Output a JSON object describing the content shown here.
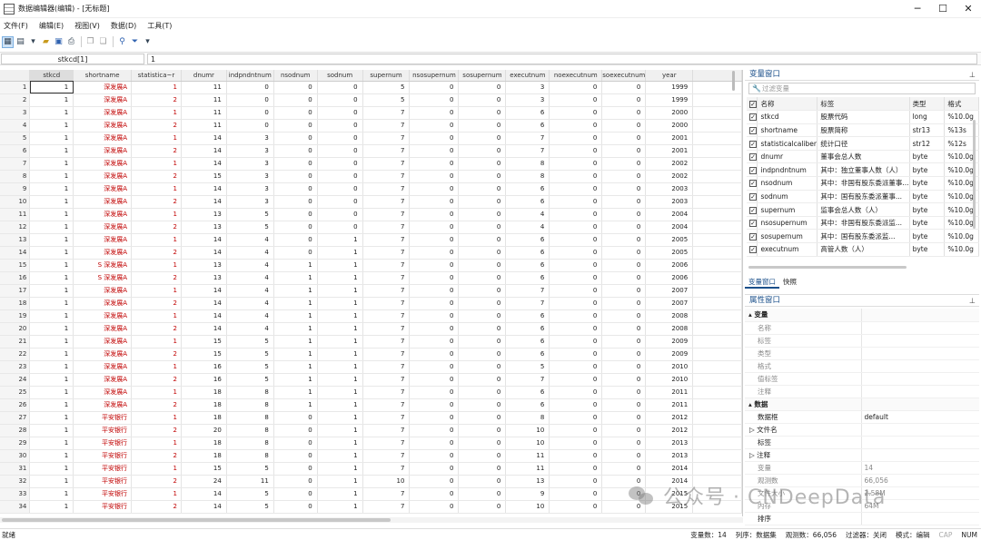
{
  "window": {
    "title": "数据编辑器(编辑) - [无标题]",
    "controls": [
      "─",
      "☐",
      "✕"
    ]
  },
  "menu": [
    "文件(F)",
    "编辑(E)",
    "视图(V)",
    "数据(D)",
    "工具(T)"
  ],
  "cellref": {
    "name": "stkcd[1]",
    "value": "1"
  },
  "grid": {
    "columns": [
      "stkcd",
      "shortname",
      "statistica~r",
      "dnumr",
      "indpndntnum",
      "nsodnum",
      "sodnum",
      "supernum",
      "nsosupernum",
      "sosupernum",
      "executnum",
      "noexecutnum",
      "soexecutnum",
      "year"
    ],
    "rows": [
      [
        "1",
        "深发展A",
        "1",
        "11",
        "0",
        "0",
        "0",
        "5",
        "0",
        "0",
        "3",
        "0",
        "0",
        "1999"
      ],
      [
        "1",
        "深发展A",
        "2",
        "11",
        "0",
        "0",
        "0",
        "5",
        "0",
        "0",
        "3",
        "0",
        "0",
        "1999"
      ],
      [
        "1",
        "深发展A",
        "1",
        "11",
        "0",
        "0",
        "0",
        "7",
        "0",
        "0",
        "6",
        "0",
        "0",
        "2000"
      ],
      [
        "1",
        "深发展A",
        "2",
        "11",
        "0",
        "0",
        "0",
        "7",
        "0",
        "0",
        "6",
        "0",
        "0",
        "2000"
      ],
      [
        "1",
        "深发展A",
        "1",
        "14",
        "3",
        "0",
        "0",
        "7",
        "0",
        "0",
        "7",
        "0",
        "0",
        "2001"
      ],
      [
        "1",
        "深发展A",
        "2",
        "14",
        "3",
        "0",
        "0",
        "7",
        "0",
        "0",
        "7",
        "0",
        "0",
        "2001"
      ],
      [
        "1",
        "深发展A",
        "1",
        "14",
        "3",
        "0",
        "0",
        "7",
        "0",
        "0",
        "8",
        "0",
        "0",
        "2002"
      ],
      [
        "1",
        "深发展A",
        "2",
        "15",
        "3",
        "0",
        "0",
        "7",
        "0",
        "0",
        "8",
        "0",
        "0",
        "2002"
      ],
      [
        "1",
        "深发展A",
        "1",
        "14",
        "3",
        "0",
        "0",
        "7",
        "0",
        "0",
        "6",
        "0",
        "0",
        "2003"
      ],
      [
        "1",
        "深发展A",
        "2",
        "14",
        "3",
        "0",
        "0",
        "7",
        "0",
        "0",
        "6",
        "0",
        "0",
        "2003"
      ],
      [
        "1",
        "深发展A",
        "1",
        "13",
        "5",
        "0",
        "0",
        "7",
        "0",
        "0",
        "4",
        "0",
        "0",
        "2004"
      ],
      [
        "1",
        "深发展A",
        "2",
        "13",
        "5",
        "0",
        "0",
        "7",
        "0",
        "0",
        "4",
        "0",
        "0",
        "2004"
      ],
      [
        "1",
        "深发展A",
        "1",
        "14",
        "4",
        "0",
        "1",
        "7",
        "0",
        "0",
        "6",
        "0",
        "0",
        "2005"
      ],
      [
        "1",
        "深发展A",
        "2",
        "14",
        "4",
        "0",
        "1",
        "7",
        "0",
        "0",
        "6",
        "0",
        "0",
        "2005"
      ],
      [
        "1",
        "S 深发展A",
        "1",
        "13",
        "4",
        "1",
        "1",
        "7",
        "0",
        "0",
        "6",
        "0",
        "0",
        "2006"
      ],
      [
        "1",
        "S 深发展A",
        "2",
        "13",
        "4",
        "1",
        "1",
        "7",
        "0",
        "0",
        "6",
        "0",
        "0",
        "2006"
      ],
      [
        "1",
        "深发展A",
        "1",
        "14",
        "4",
        "1",
        "1",
        "7",
        "0",
        "0",
        "7",
        "0",
        "0",
        "2007"
      ],
      [
        "1",
        "深发展A",
        "2",
        "14",
        "4",
        "1",
        "1",
        "7",
        "0",
        "0",
        "7",
        "0",
        "0",
        "2007"
      ],
      [
        "1",
        "深发展A",
        "1",
        "14",
        "4",
        "1",
        "1",
        "7",
        "0",
        "0",
        "6",
        "0",
        "0",
        "2008"
      ],
      [
        "1",
        "深发展A",
        "2",
        "14",
        "4",
        "1",
        "1",
        "7",
        "0",
        "0",
        "6",
        "0",
        "0",
        "2008"
      ],
      [
        "1",
        "深发展A",
        "1",
        "15",
        "5",
        "1",
        "1",
        "7",
        "0",
        "0",
        "6",
        "0",
        "0",
        "2009"
      ],
      [
        "1",
        "深发展A",
        "2",
        "15",
        "5",
        "1",
        "1",
        "7",
        "0",
        "0",
        "6",
        "0",
        "0",
        "2009"
      ],
      [
        "1",
        "深发展A",
        "1",
        "16",
        "5",
        "1",
        "1",
        "7",
        "0",
        "0",
        "5",
        "0",
        "0",
        "2010"
      ],
      [
        "1",
        "深发展A",
        "2",
        "16",
        "5",
        "1",
        "1",
        "7",
        "0",
        "0",
        "7",
        "0",
        "0",
        "2010"
      ],
      [
        "1",
        "深发展A",
        "1",
        "18",
        "8",
        "1",
        "1",
        "7",
        "0",
        "0",
        "6",
        "0",
        "0",
        "2011"
      ],
      [
        "1",
        "深发展A",
        "2",
        "18",
        "8",
        "1",
        "1",
        "7",
        "0",
        "0",
        "6",
        "0",
        "0",
        "2011"
      ],
      [
        "1",
        "平安银行",
        "1",
        "18",
        "8",
        "0",
        "1",
        "7",
        "0",
        "0",
        "8",
        "0",
        "0",
        "2012"
      ],
      [
        "1",
        "平安银行",
        "2",
        "20",
        "8",
        "0",
        "1",
        "7",
        "0",
        "0",
        "10",
        "0",
        "0",
        "2012"
      ],
      [
        "1",
        "平安银行",
        "1",
        "18",
        "8",
        "0",
        "1",
        "7",
        "0",
        "0",
        "10",
        "0",
        "0",
        "2013"
      ],
      [
        "1",
        "平安银行",
        "2",
        "18",
        "8",
        "0",
        "1",
        "7",
        "0",
        "0",
        "11",
        "0",
        "0",
        "2013"
      ],
      [
        "1",
        "平安银行",
        "1",
        "15",
        "5",
        "0",
        "1",
        "7",
        "0",
        "0",
        "11",
        "0",
        "0",
        "2014"
      ],
      [
        "1",
        "平安银行",
        "2",
        "24",
        "11",
        "0",
        "1",
        "10",
        "0",
        "0",
        "13",
        "0",
        "0",
        "2014"
      ],
      [
        "1",
        "平安银行",
        "1",
        "14",
        "5",
        "0",
        "1",
        "7",
        "0",
        "0",
        "9",
        "0",
        "0",
        "2015"
      ],
      [
        "1",
        "平安银行",
        "2",
        "14",
        "5",
        "0",
        "1",
        "7",
        "0",
        "0",
        "10",
        "0",
        "0",
        "2015"
      ]
    ]
  },
  "varwin": {
    "title": "变量窗口",
    "filter_placeholder": "过滤变量",
    "headers": [
      "名称",
      "标签",
      "类型",
      "格式"
    ],
    "vars": [
      [
        "stkcd",
        "股票代码",
        "long",
        "%10.0g"
      ],
      [
        "shortname",
        "股票简称",
        "str13",
        "%13s"
      ],
      [
        "statisticalcaliber",
        "统计口径",
        "str12",
        "%12s"
      ],
      [
        "dnumr",
        "董事会总人数",
        "byte",
        "%10.0g"
      ],
      [
        "indpndntnum",
        "其中：独立董事人数（人）",
        "byte",
        "%10.0g"
      ],
      [
        "nsodnum",
        "其中：非国有股东委派董事...",
        "byte",
        "%10.0g"
      ],
      [
        "sodnum",
        "其中：国有股东委派董事...",
        "byte",
        "%10.0g"
      ],
      [
        "supernum",
        "监事会总人数（人）",
        "byte",
        "%10.0g"
      ],
      [
        "nsosupernum",
        "其中：非国有股东委派监...",
        "byte",
        "%10.0g"
      ],
      [
        "sosupernum",
        "其中：国有股东委派监...",
        "byte",
        "%10.0g"
      ],
      [
        "executnum",
        "高管人数（人）",
        "byte",
        "%10.0g"
      ]
    ]
  },
  "tabs": [
    "变量窗口",
    "快照"
  ],
  "props": {
    "title": "属性窗口",
    "rows": [
      {
        "t": "grp",
        "k": "▴ 变量",
        "v": ""
      },
      {
        "t": "row",
        "k": "名称",
        "v": ""
      },
      {
        "t": "row",
        "k": "标签",
        "v": ""
      },
      {
        "t": "row",
        "k": "类型",
        "v": ""
      },
      {
        "t": "row",
        "k": "格式",
        "v": ""
      },
      {
        "t": "row",
        "k": "值标签",
        "v": ""
      },
      {
        "t": "row",
        "k": "注释",
        "v": ""
      },
      {
        "t": "grp",
        "k": "▴ 数据",
        "v": ""
      },
      {
        "t": "dark",
        "k": "数据框",
        "v": "default"
      },
      {
        "t": "exp",
        "k": "▷ 文件名",
        "v": ""
      },
      {
        "t": "dark",
        "k": "标签",
        "v": ""
      },
      {
        "t": "exp",
        "k": "▷ 注释",
        "v": ""
      },
      {
        "t": "row",
        "k": "变量",
        "v": "14"
      },
      {
        "t": "row",
        "k": "观测数",
        "v": "66,056"
      },
      {
        "t": "row",
        "k": "文件大小",
        "v": "2.58M"
      },
      {
        "t": "row",
        "k": "内存",
        "v": "64M"
      },
      {
        "t": "dark",
        "k": "排序",
        "v": ""
      }
    ]
  },
  "status": {
    "left": "就绪",
    "vars": "变量数：14",
    "order": "列序：数据集",
    "obs": "观测数：66,056",
    "filter": "过滤器：关闭",
    "mode": "模式：编辑",
    "cap": "CAP",
    "num": "NUM"
  },
  "watermark": "公众号 · CNDeepData"
}
